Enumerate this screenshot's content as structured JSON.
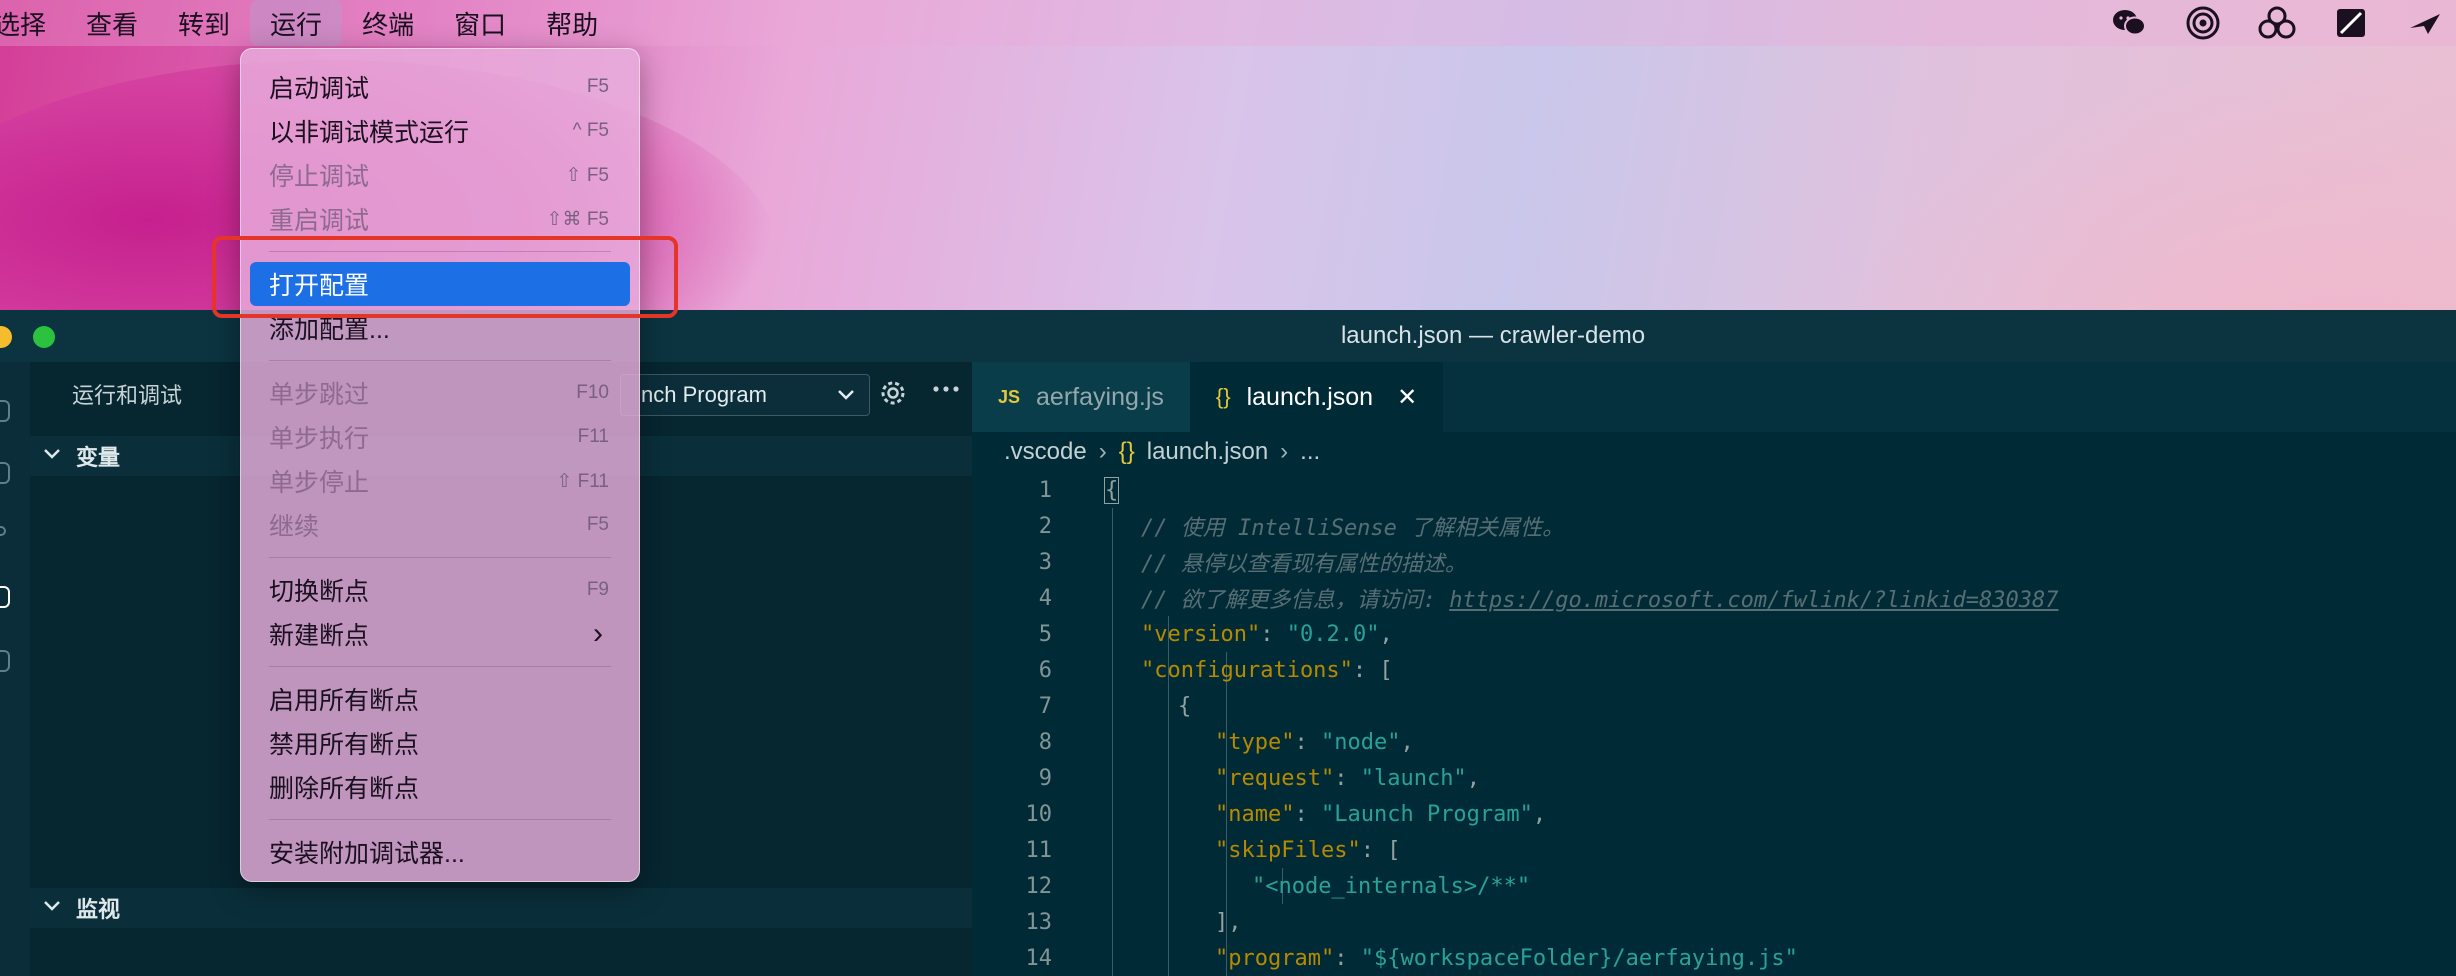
{
  "menubar": {
    "items": [
      "选择",
      "查看",
      "转到",
      "运行",
      "终端",
      "窗口",
      "帮助"
    ],
    "active_index": 3,
    "status_icons": [
      "wechat-icon",
      "airdrop-icon",
      "cluster-icon",
      "screen-icon",
      "airplane-icon"
    ]
  },
  "run_menu": {
    "groups": [
      [
        {
          "label": "启动调试",
          "shortcut": "F5",
          "enabled": true
        },
        {
          "label": "以非调试模式运行",
          "shortcut": "^ F5",
          "enabled": true
        },
        {
          "label": "停止调试",
          "shortcut": "⇧ F5",
          "enabled": false
        },
        {
          "label": "重启调试",
          "shortcut": "⇧⌘ F5",
          "enabled": false
        }
      ],
      [
        {
          "label": "打开配置",
          "shortcut": "",
          "enabled": true,
          "highlighted": true
        },
        {
          "label": "添加配置...",
          "shortcut": "",
          "enabled": true
        }
      ],
      [
        {
          "label": "单步跳过",
          "shortcut": "F10",
          "enabled": false
        },
        {
          "label": "单步执行",
          "shortcut": "F11",
          "enabled": false
        },
        {
          "label": "单步停止",
          "shortcut": "⇧ F11",
          "enabled": false
        },
        {
          "label": "继续",
          "shortcut": "F5",
          "enabled": false
        }
      ],
      [
        {
          "label": "切换断点",
          "shortcut": "F9",
          "enabled": true
        },
        {
          "label": "新建断点",
          "shortcut": "",
          "enabled": true,
          "submenu": true
        }
      ],
      [
        {
          "label": "启用所有断点",
          "shortcut": "",
          "enabled": true
        },
        {
          "label": "禁用所有断点",
          "shortcut": "",
          "enabled": true
        },
        {
          "label": "删除所有断点",
          "shortcut": "",
          "enabled": true
        }
      ],
      [
        {
          "label": "安装附加调试器...",
          "shortcut": "",
          "enabled": true
        }
      ]
    ]
  },
  "window": {
    "title": "launch.json — crawler-demo"
  },
  "sidebar": {
    "title": "运行和调试",
    "config_select": "nch Program",
    "variables_label": "变量",
    "watch_label": "监视"
  },
  "editor": {
    "tabs": [
      {
        "label": "aerfaying.js",
        "icon": "JS",
        "active": false
      },
      {
        "label": "launch.json",
        "icon": "{}",
        "active": true
      }
    ],
    "breadcrumbs": [
      ".vscode",
      "launch.json",
      "..."
    ],
    "lines": [
      {
        "n": "1"
      },
      {
        "n": "2",
        "text": "// 使用 IntelliSense 了解相关属性。"
      },
      {
        "n": "3",
        "text": "// 悬停以查看现有属性的描述。"
      },
      {
        "n": "4",
        "text": "// 欲了解更多信息，请访问: ",
        "link": "https://go.microsoft.com/fwlink/?linkid=830387"
      },
      {
        "n": "5",
        "key": "\"version\"",
        "value": "\"0.2.0\"",
        "tail": ","
      },
      {
        "n": "6",
        "key": "\"configurations\"",
        "tail": ": ["
      },
      {
        "n": "7",
        "text": "{"
      },
      {
        "n": "8",
        "key": "\"type\"",
        "value": "\"node\"",
        "tail": ","
      },
      {
        "n": "9",
        "key": "\"request\"",
        "value": "\"launch\"",
        "tail": ","
      },
      {
        "n": "10",
        "key": "\"name\"",
        "value": "\"Launch Program\"",
        "tail": ","
      },
      {
        "n": "11",
        "key": "\"skipFiles\"",
        "tail": ": ["
      },
      {
        "n": "12",
        "value": "\"<node_internals>/**\""
      },
      {
        "n": "13",
        "text": "],"
      },
      {
        "n": "14",
        "key": "\"program\"",
        "value": "\"${workspaceFolder}/aerfaying.js\""
      }
    ]
  },
  "colors": {
    "highlight": "#1d6fe6",
    "annotation_box": "#e53528",
    "json_key": "#b58900",
    "json_string": "#2aa198"
  }
}
